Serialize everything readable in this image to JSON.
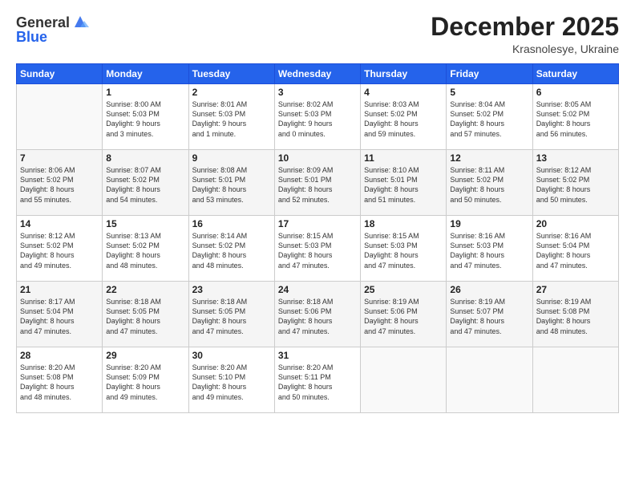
{
  "header": {
    "logo_line1": "General",
    "logo_line2": "Blue",
    "month": "December 2025",
    "location": "Krasnolesye, Ukraine"
  },
  "days_of_week": [
    "Sunday",
    "Monday",
    "Tuesday",
    "Wednesday",
    "Thursday",
    "Friday",
    "Saturday"
  ],
  "weeks": [
    [
      {
        "day": "",
        "info": ""
      },
      {
        "day": "1",
        "info": "Sunrise: 8:00 AM\nSunset: 5:03 PM\nDaylight: 9 hours\nand 3 minutes."
      },
      {
        "day": "2",
        "info": "Sunrise: 8:01 AM\nSunset: 5:03 PM\nDaylight: 9 hours\nand 1 minute."
      },
      {
        "day": "3",
        "info": "Sunrise: 8:02 AM\nSunset: 5:03 PM\nDaylight: 9 hours\nand 0 minutes."
      },
      {
        "day": "4",
        "info": "Sunrise: 8:03 AM\nSunset: 5:02 PM\nDaylight: 8 hours\nand 59 minutes."
      },
      {
        "day": "5",
        "info": "Sunrise: 8:04 AM\nSunset: 5:02 PM\nDaylight: 8 hours\nand 57 minutes."
      },
      {
        "day": "6",
        "info": "Sunrise: 8:05 AM\nSunset: 5:02 PM\nDaylight: 8 hours\nand 56 minutes."
      }
    ],
    [
      {
        "day": "7",
        "info": "Sunrise: 8:06 AM\nSunset: 5:02 PM\nDaylight: 8 hours\nand 55 minutes."
      },
      {
        "day": "8",
        "info": "Sunrise: 8:07 AM\nSunset: 5:02 PM\nDaylight: 8 hours\nand 54 minutes."
      },
      {
        "day": "9",
        "info": "Sunrise: 8:08 AM\nSunset: 5:01 PM\nDaylight: 8 hours\nand 53 minutes."
      },
      {
        "day": "10",
        "info": "Sunrise: 8:09 AM\nSunset: 5:01 PM\nDaylight: 8 hours\nand 52 minutes."
      },
      {
        "day": "11",
        "info": "Sunrise: 8:10 AM\nSunset: 5:01 PM\nDaylight: 8 hours\nand 51 minutes."
      },
      {
        "day": "12",
        "info": "Sunrise: 8:11 AM\nSunset: 5:02 PM\nDaylight: 8 hours\nand 50 minutes."
      },
      {
        "day": "13",
        "info": "Sunrise: 8:12 AM\nSunset: 5:02 PM\nDaylight: 8 hours\nand 50 minutes."
      }
    ],
    [
      {
        "day": "14",
        "info": "Sunrise: 8:12 AM\nSunset: 5:02 PM\nDaylight: 8 hours\nand 49 minutes."
      },
      {
        "day": "15",
        "info": "Sunrise: 8:13 AM\nSunset: 5:02 PM\nDaylight: 8 hours\nand 48 minutes."
      },
      {
        "day": "16",
        "info": "Sunrise: 8:14 AM\nSunset: 5:02 PM\nDaylight: 8 hours\nand 48 minutes."
      },
      {
        "day": "17",
        "info": "Sunrise: 8:15 AM\nSunset: 5:03 PM\nDaylight: 8 hours\nand 47 minutes."
      },
      {
        "day": "18",
        "info": "Sunrise: 8:15 AM\nSunset: 5:03 PM\nDaylight: 8 hours\nand 47 minutes."
      },
      {
        "day": "19",
        "info": "Sunrise: 8:16 AM\nSunset: 5:03 PM\nDaylight: 8 hours\nand 47 minutes."
      },
      {
        "day": "20",
        "info": "Sunrise: 8:16 AM\nSunset: 5:04 PM\nDaylight: 8 hours\nand 47 minutes."
      }
    ],
    [
      {
        "day": "21",
        "info": "Sunrise: 8:17 AM\nSunset: 5:04 PM\nDaylight: 8 hours\nand 47 minutes."
      },
      {
        "day": "22",
        "info": "Sunrise: 8:18 AM\nSunset: 5:05 PM\nDaylight: 8 hours\nand 47 minutes."
      },
      {
        "day": "23",
        "info": "Sunrise: 8:18 AM\nSunset: 5:05 PM\nDaylight: 8 hours\nand 47 minutes."
      },
      {
        "day": "24",
        "info": "Sunrise: 8:18 AM\nSunset: 5:06 PM\nDaylight: 8 hours\nand 47 minutes."
      },
      {
        "day": "25",
        "info": "Sunrise: 8:19 AM\nSunset: 5:06 PM\nDaylight: 8 hours\nand 47 minutes."
      },
      {
        "day": "26",
        "info": "Sunrise: 8:19 AM\nSunset: 5:07 PM\nDaylight: 8 hours\nand 47 minutes."
      },
      {
        "day": "27",
        "info": "Sunrise: 8:19 AM\nSunset: 5:08 PM\nDaylight: 8 hours\nand 48 minutes."
      }
    ],
    [
      {
        "day": "28",
        "info": "Sunrise: 8:20 AM\nSunset: 5:08 PM\nDaylight: 8 hours\nand 48 minutes."
      },
      {
        "day": "29",
        "info": "Sunrise: 8:20 AM\nSunset: 5:09 PM\nDaylight: 8 hours\nand 49 minutes."
      },
      {
        "day": "30",
        "info": "Sunrise: 8:20 AM\nSunset: 5:10 PM\nDaylight: 8 hours\nand 49 minutes."
      },
      {
        "day": "31",
        "info": "Sunrise: 8:20 AM\nSunset: 5:11 PM\nDaylight: 8 hours\nand 50 minutes."
      },
      {
        "day": "",
        "info": ""
      },
      {
        "day": "",
        "info": ""
      },
      {
        "day": "",
        "info": ""
      }
    ]
  ]
}
